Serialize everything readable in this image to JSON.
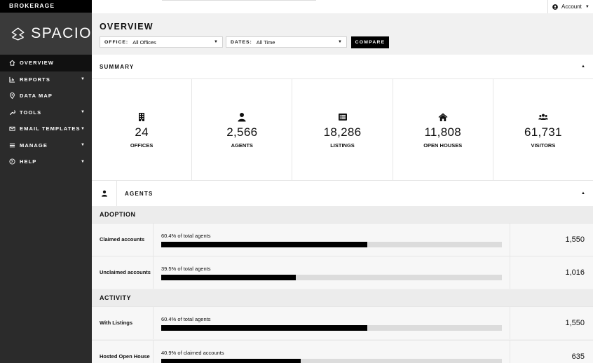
{
  "sidebar": {
    "brokerage": "BROKERAGE",
    "logo_text": "SPACIO",
    "items": [
      {
        "label": "OVERVIEW",
        "icon": "home-icon",
        "active": true,
        "caret": false
      },
      {
        "label": "REPORTS",
        "icon": "chart-icon",
        "active": false,
        "caret": true
      },
      {
        "label": "DATA MAP",
        "icon": "map-pin-icon",
        "active": false,
        "caret": false
      },
      {
        "label": "TOOLS",
        "icon": "wrench-icon",
        "active": false,
        "caret": true
      },
      {
        "label": "EMAIL TEMPLATES",
        "icon": "envelope-icon",
        "active": false,
        "caret": true
      },
      {
        "label": "MANAGE",
        "icon": "list-icon",
        "active": false,
        "caret": true
      },
      {
        "label": "HELP",
        "icon": "question-icon",
        "active": false,
        "caret": true
      }
    ]
  },
  "topbar": {
    "account_label": "Account"
  },
  "overview": {
    "title": "OVERVIEW",
    "office_label": "OFFICE:",
    "office_value": "All Offices",
    "dates_label": "DATES:",
    "dates_value": "All Time",
    "compare_label": "COMPARE"
  },
  "summary": {
    "title": "SUMMARY",
    "stats": [
      {
        "icon": "building-icon",
        "value": "24",
        "label": "OFFICES"
      },
      {
        "icon": "user-icon",
        "value": "2,566",
        "label": "AGENTS"
      },
      {
        "icon": "listing-icon",
        "value": "18,286",
        "label": "LISTINGS"
      },
      {
        "icon": "house-icon",
        "value": "11,808",
        "label": "OPEN HOUSES"
      },
      {
        "icon": "users-icon",
        "value": "61,731",
        "label": "VISITORS"
      }
    ]
  },
  "agents": {
    "title": "AGENTS",
    "adoption_title": "ADOPTION",
    "activity_title": "ACTIVITY",
    "adoption_rows": [
      {
        "label": "Claimed accounts",
        "note": "60.4% of total agents",
        "fraction": 0.604,
        "value": "1,550"
      },
      {
        "label": "Unclaimed accounts",
        "note": "39.5% of total agents",
        "fraction": 0.395,
        "value": "1,016"
      }
    ],
    "activity_rows": [
      {
        "label": "With Listings",
        "note": "60.4% of total agents",
        "fraction": 0.604,
        "value": "1,550"
      },
      {
        "label": "Hosted Open House",
        "note": "40.9% of claimed accounts",
        "fraction": 0.409,
        "value": "635"
      }
    ]
  },
  "colors": {
    "sidebar": "#2b2b2b",
    "active": "#111111",
    "bar_fill": "#000000",
    "bar_track": "#dcdcdc"
  }
}
